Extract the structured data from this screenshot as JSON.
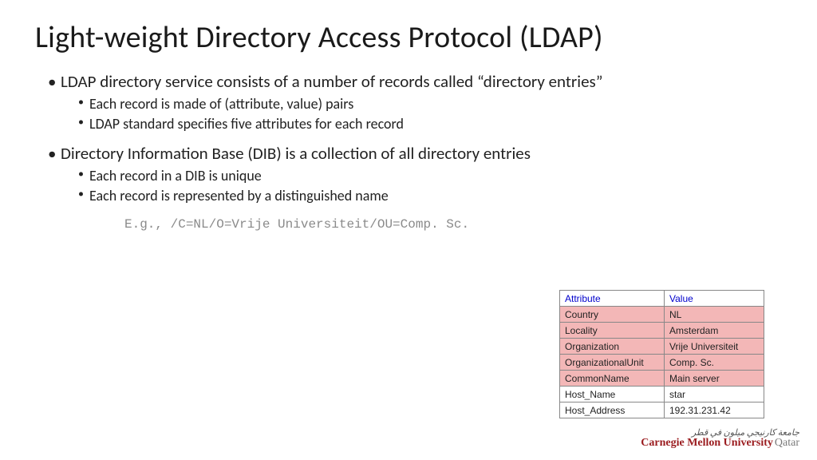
{
  "title": "Light-weight Directory Access Protocol (LDAP)",
  "bullets": [
    {
      "text": "LDAP directory service consists of a number of records called “directory entries”",
      "sub": [
        "Each record is made of (attribute, value) pairs",
        "LDAP standard specifies five attributes for each record"
      ]
    },
    {
      "text": "Directory Information Base (DIB) is a collection of all directory entries",
      "sub": [
        "Each record in a DIB is unique",
        "Each record is represented by a distinguished name"
      ]
    }
  ],
  "example": "E.g., /C=NL/O=Vrije Universiteit/OU=Comp. Sc.",
  "table": {
    "headers": {
      "attr": "Attribute",
      "value": "Value"
    },
    "rows": [
      {
        "attr": "Country",
        "value": "NL",
        "highlight": true
      },
      {
        "attr": "Locality",
        "value": "Amsterdam",
        "highlight": true
      },
      {
        "attr": "Organization",
        "value": "Vrije Universiteit",
        "highlight": true
      },
      {
        "attr": "OrganizationalUnit",
        "value": "Comp. Sc.",
        "highlight": true
      },
      {
        "attr": "CommonName",
        "value": "Main server",
        "highlight": true
      },
      {
        "attr": "Host_Name",
        "value": "star",
        "highlight": false
      },
      {
        "attr": "Host_Address",
        "value": "192.31.231.42",
        "highlight": false
      }
    ]
  },
  "footer": {
    "arabic": "جامعة كارنيجي ميلون في قطر",
    "main": "Carnegie Mellon University",
    "suffix": "Qatar"
  }
}
